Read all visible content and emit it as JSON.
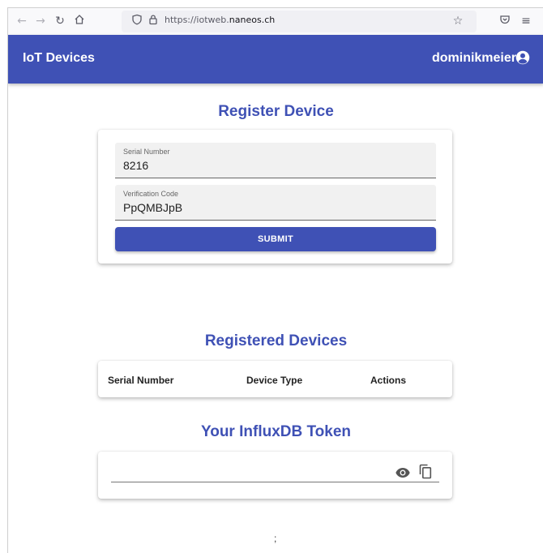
{
  "browser": {
    "url_prefix": "https://iotweb.",
    "url_domain": "naneos.ch"
  },
  "appbar": {
    "title": "IoT Devices",
    "username": "dominikmeier"
  },
  "register": {
    "heading": "Register Device",
    "serial_label": "Serial Number",
    "serial_value": "8216",
    "code_label": "Verification Code",
    "code_value": "PpQMBJpB",
    "submit_label": "SUBMIT"
  },
  "devices": {
    "heading": "Registered Devices",
    "columns": [
      "Serial Number",
      "Device Type",
      "Actions"
    ]
  },
  "token": {
    "heading": "Your InfluxDB Token",
    "value": ""
  },
  "footer": {
    "text": ";"
  },
  "colors": {
    "primary": "#3f51b5"
  }
}
